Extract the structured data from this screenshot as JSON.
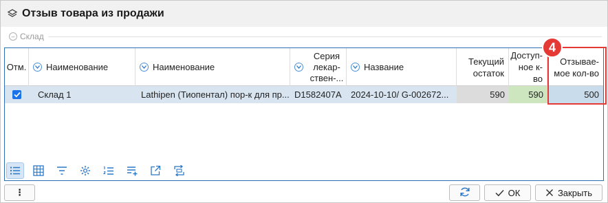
{
  "window": {
    "title": "Отзыв товара из продажи",
    "icon": "layers-icon"
  },
  "group": {
    "label": "Склад",
    "icon": "collapse-icon"
  },
  "grid": {
    "columns": [
      {
        "label": "Отм.",
        "sort_icon": false
      },
      {
        "label": "Наименование",
        "sort_icon": true
      },
      {
        "label": "Наименование",
        "sort_icon": true
      },
      {
        "label": "Серия лекар-ствен-...",
        "sort_icon": true
      },
      {
        "label": "Название",
        "sort_icon": true
      },
      {
        "label": "Текущий остаток",
        "sort_icon": false
      },
      {
        "label": "Доступ-ное к-во",
        "sort_icon": false
      },
      {
        "label": "Отзывае-мое кол-во",
        "sort_icon": false
      }
    ],
    "rows": [
      {
        "checked": true,
        "warehouse": "Склад 1",
        "product": "Lathipen (Тиопентал) пор-к для пр...",
        "series": "D1582407A",
        "name": "2024-10-10/ G-002672...",
        "current_stock": "590",
        "available_qty": "590",
        "recall_qty": "500"
      }
    ]
  },
  "annotation": {
    "badge": "4",
    "color": "#e53935"
  },
  "toolbar": [
    "list-view-icon",
    "grid-view-icon",
    "filter-icon",
    "settings-icon",
    "numbered-list-icon",
    "add-row-icon",
    "export-icon",
    "swap-icon"
  ],
  "buttons": {
    "more": "⋮",
    "refresh": "",
    "ok": "ОК",
    "close": "Закрыть"
  }
}
